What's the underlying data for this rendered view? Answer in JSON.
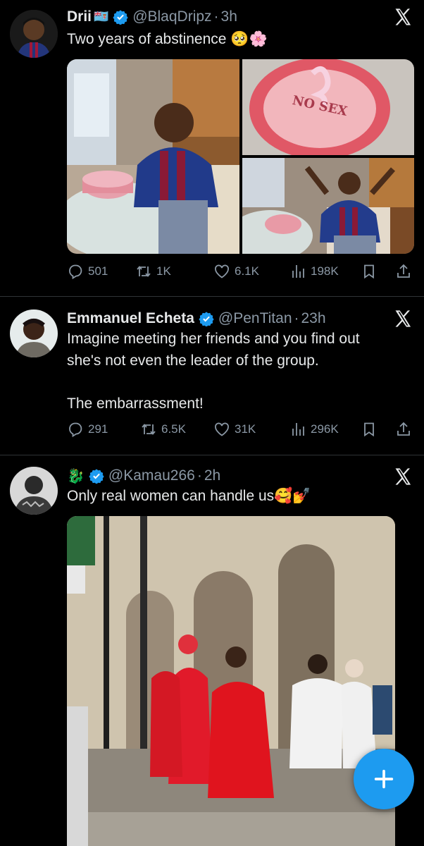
{
  "tweets": [
    {
      "name": "Drii",
      "flag_emoji": "🇫🇯",
      "handle": "@BlaqDripz",
      "time": "3h",
      "text": "Two years of abstinence",
      "text_emoji": "🥺🌸",
      "replies": "501",
      "reposts": "1K",
      "likes": "6.1K",
      "views": "198K",
      "media_text": "NO SEX"
    },
    {
      "name": "Emmanuel Echeta",
      "handle": "@PenTitan",
      "time": "23h",
      "text_line1": "Imagine meeting her friends and you find out",
      "text_line2": "she's not even the leader of the group.",
      "text_line3": "The embarrassment!",
      "replies": "291",
      "reposts": "6.5K",
      "likes": "31K",
      "views": "296K"
    },
    {
      "name_emoji": "🐉",
      "handle": "@Kamau266",
      "time": "2h",
      "text": "Only real women can handle us",
      "text_emoji": "🥰💅"
    }
  ],
  "colors": {
    "accent": "#1d9bf0",
    "text": "#e7e9ea",
    "muted": "#8b98a5",
    "background": "#000000",
    "divider": "#2f3336"
  },
  "icons": [
    "verified-icon",
    "x-logo-icon",
    "reply-icon",
    "repost-icon",
    "like-icon",
    "views-icon",
    "bookmark-icon",
    "share-icon",
    "compose-icon"
  ]
}
